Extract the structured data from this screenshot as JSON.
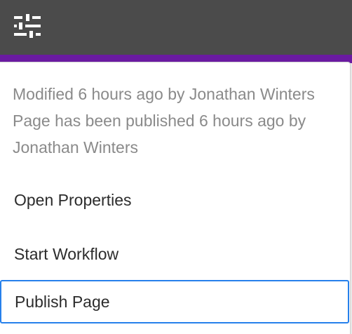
{
  "toolbar": {
    "settings_icon": "sliders-icon",
    "background_color": "#4b4b4b",
    "accent_color": "#6a1aa1"
  },
  "panel": {
    "meta_lines": [
      "Modified 6 hours ago by Jonathan Winters",
      "Page has been published 6 hours ago by",
      "Jonathan Winters"
    ],
    "actions": {
      "open_properties": "Open Properties",
      "start_workflow": "Start Workflow",
      "publish_page": "Publish Page"
    },
    "focus_color": "#2680eb"
  }
}
